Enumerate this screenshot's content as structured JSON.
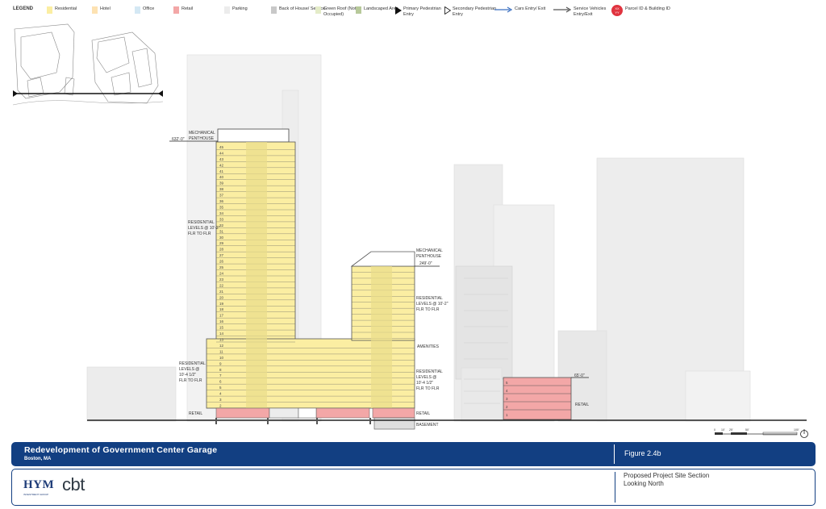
{
  "legend": {
    "title": "LEGEND",
    "items": [
      {
        "label": "Residential",
        "color": "#fbeea2",
        "type": "swatch"
      },
      {
        "label": "Hotel",
        "color": "#fde2b2",
        "type": "swatch"
      },
      {
        "label": "Office",
        "color": "#d4e8f4",
        "type": "swatch"
      },
      {
        "label": "Retail",
        "color": "#f3a7a7",
        "type": "swatch"
      },
      {
        "label": "Parking",
        "color": "#ececec",
        "type": "swatch"
      },
      {
        "label": "Back of House/ Service",
        "color": "#c8c8c8",
        "type": "swatch"
      },
      {
        "label": "Green Roof (Not Occupied)",
        "color": "#e4ecc8",
        "type": "swatch"
      },
      {
        "label": "Landscaped Area",
        "color": "#b7c99a",
        "type": "swatch"
      },
      {
        "label": "Primary Pedestrian Entry",
        "icon": "filled-triangle-icon"
      },
      {
        "label": "Secondary Pedestrian Entry",
        "icon": "outline-triangle-icon"
      },
      {
        "label": "Cars Entry/ Exit",
        "icon": "blue-arrow-icon"
      },
      {
        "label": "Service Vehicles Entry/Exit",
        "icon": "gray-arrow-icon"
      },
      {
        "label": "Parcel ID & Building ID",
        "icon": "parcel-id-badge-icon",
        "badge": "XX YY",
        "color": "#e0343f"
      }
    ]
  },
  "annotations": {
    "tower_mech": "MECHANICAL PENTHOUSE",
    "tower_elev": "632'-0\"",
    "tower_res": "RESIDENTIAL LEVELS @ 10'-2\" FLR TO FLR",
    "tower_low_res": "RESIDENTIAL LEVELS @ 10'-4 1/2\" FLR TO FLR",
    "retail_left": "RETAIL",
    "mid_mech": "MECHANICAL PENTHOUSE",
    "mid_elev": "249'-0\"",
    "mid_res": "RESIDENTIAL LEVELS @ 10'-2\" FLR TO FLR",
    "amenities": "AMENITIES",
    "mid_low_res": "RESIDENTIAL LEVELS @ 10'-4 1/2\" FLR TO FLR",
    "retail_right": "RETAIL",
    "basement": "BASEMENT",
    "garage_elev": "65'-0\"",
    "retail_garage": "RETAIL"
  },
  "floors": {
    "tower": [
      "45",
      "44",
      "43",
      "42",
      "41",
      "40",
      "39",
      "38",
      "37",
      "36",
      "35",
      "34",
      "33",
      "32",
      "31",
      "30",
      "29",
      "28",
      "27",
      "26",
      "25",
      "24",
      "23",
      "22",
      "21",
      "20",
      "19",
      "18",
      "17",
      "16",
      "15",
      "14",
      "13",
      "12",
      "11",
      "10",
      "9",
      "8",
      "7",
      "6",
      "5",
      "4",
      "3",
      "2"
    ],
    "garage": [
      "5",
      "4",
      "3",
      "2",
      "1"
    ]
  },
  "scale": {
    "labels": [
      "0",
      "10'",
      "25'",
      "50'",
      "100'"
    ]
  },
  "title_block": {
    "title": "Redevelopment of Government Center Garage",
    "location": "Boston, MA",
    "figure": "Figure 2.4b",
    "description_line1": "Proposed Project Site Section",
    "description_line2": "Looking North",
    "logo_hym": "HYM",
    "logo_hym_sub": "INVESTMENT GROUP",
    "logo_cbt": "cbt"
  },
  "colors": {
    "brand_blue": "#123f82",
    "residential": "#fbeea2",
    "retail": "#f3a7a7",
    "parcel_red": "#e0343f"
  }
}
